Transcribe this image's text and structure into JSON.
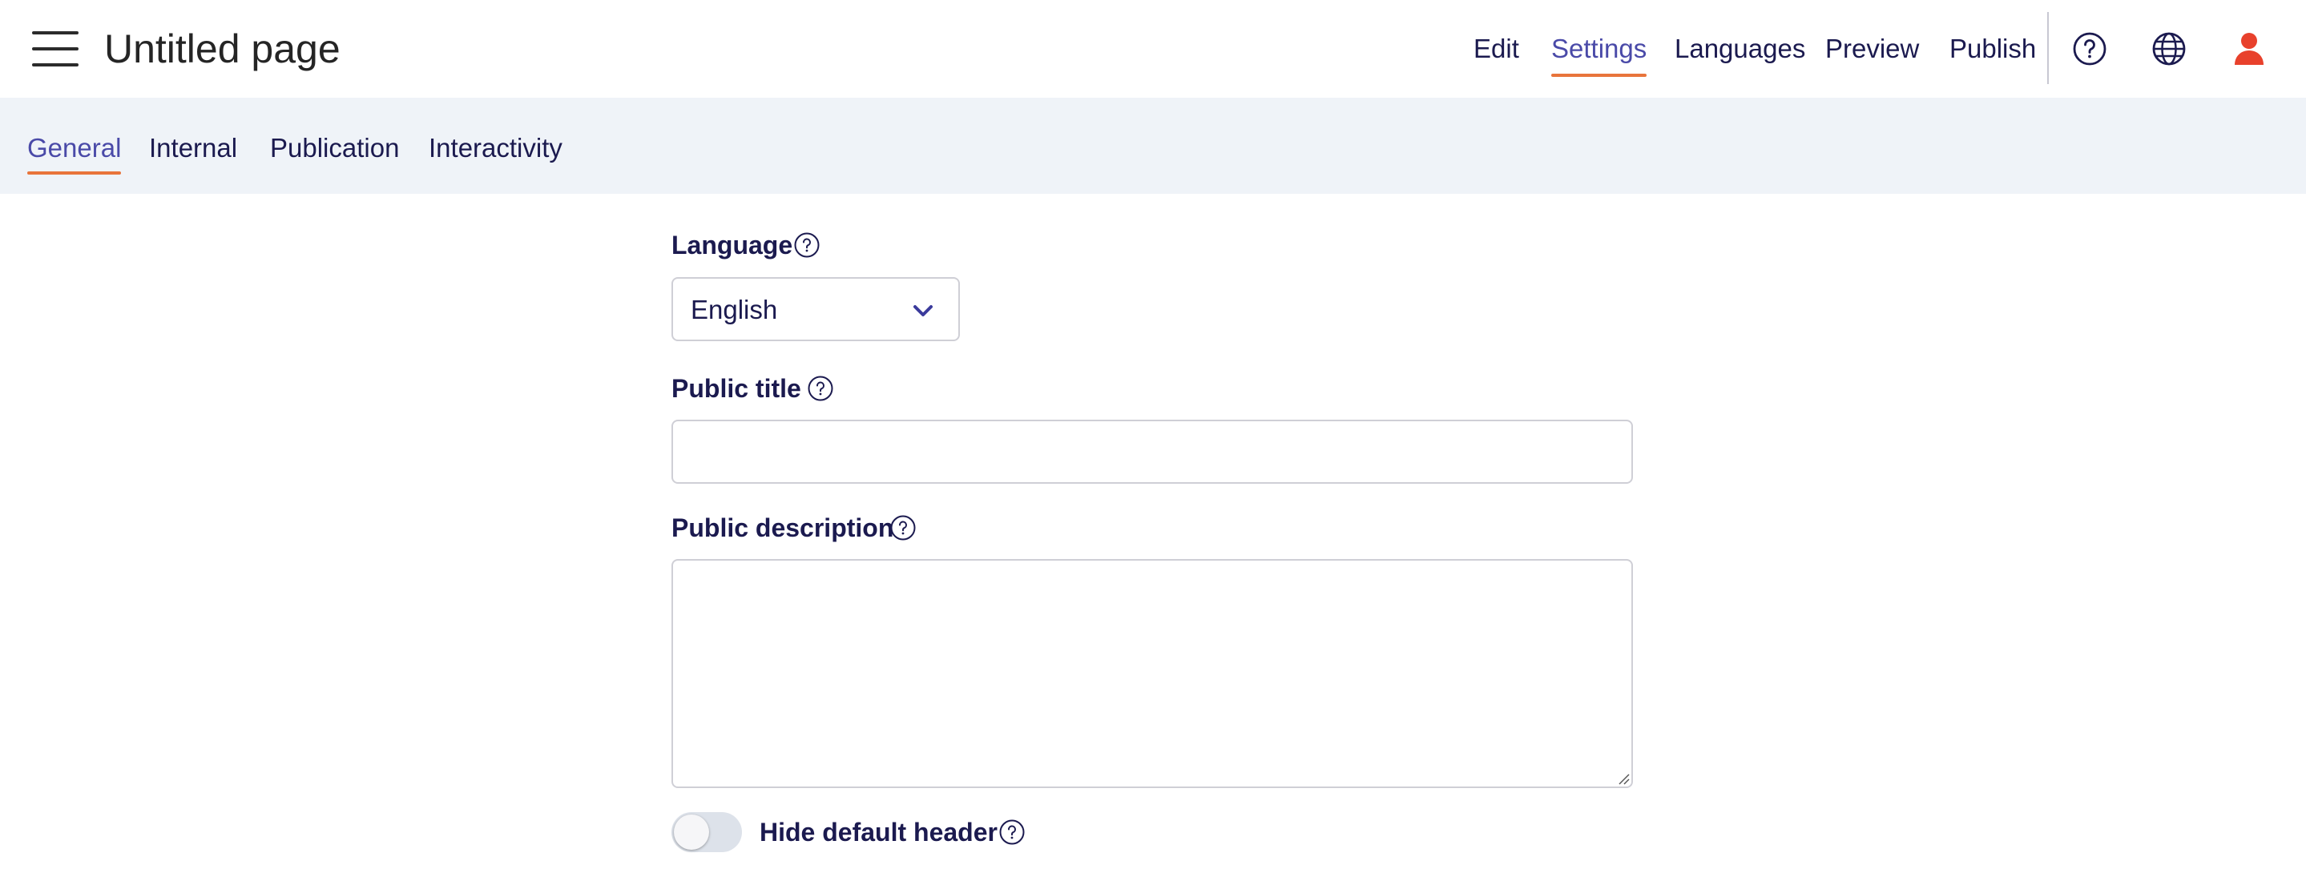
{
  "header": {
    "page_title": "Untitled page",
    "nav": [
      {
        "label": "Edit",
        "active": false
      },
      {
        "label": "Settings",
        "active": true
      },
      {
        "label": "Languages",
        "active": false
      },
      {
        "label": "Preview",
        "active": false
      },
      {
        "label": "Publish",
        "active": false
      }
    ],
    "icons": [
      "menu-icon",
      "help-icon",
      "globe-icon",
      "user-icon"
    ]
  },
  "subtabs": [
    {
      "label": "General",
      "active": true
    },
    {
      "label": "Internal",
      "active": false
    },
    {
      "label": "Publication",
      "active": false
    },
    {
      "label": "Interactivity",
      "active": false
    }
  ],
  "form": {
    "language": {
      "label": "Language",
      "selected": "English"
    },
    "public_title": {
      "label": "Public title",
      "value": "",
      "placeholder": ""
    },
    "public_description": {
      "label": "Public description",
      "value": "",
      "placeholder": ""
    },
    "hide_header": {
      "label": "Hide default header",
      "enabled": false
    }
  },
  "colors": {
    "text": "#1b1a4f",
    "active_tab": "#4a4aa8",
    "accent_underline": "#e8743b",
    "subbar_bg": "#eff3f8",
    "user_icon": "#e8412c"
  }
}
